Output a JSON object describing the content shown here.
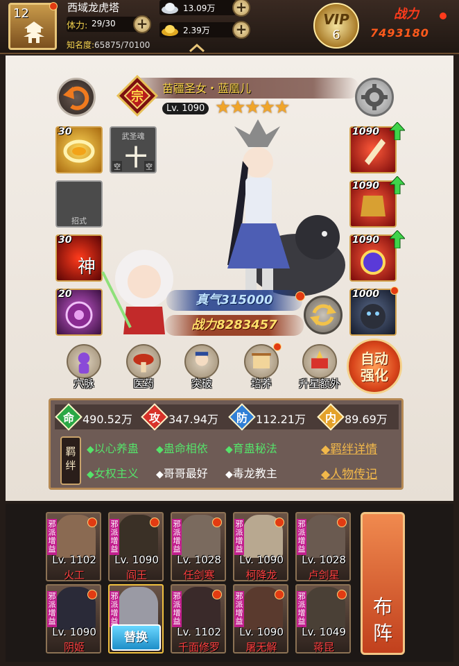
{
  "header": {
    "player_level": "12",
    "location": "西域龙虎塔",
    "stamina_label": "体力:",
    "stamina_value": "29/30",
    "fame_label": "知名度:",
    "fame_value": "65875/70100",
    "silver": "13.09万",
    "gold": "2.39万",
    "vip_label": "VIP",
    "vip_level": "6",
    "power_label": "战力",
    "power_value": "7493180"
  },
  "hero": {
    "rank_icon": "rank-badge-icon",
    "name": "苗疆圣女・蓝凰儿",
    "level": "Lv. 1090",
    "stars": "★★★★★",
    "zhenqi": "真气315000",
    "power": "战力8283457"
  },
  "left_slots": [
    {
      "level": "30",
      "icon": "gold-ring-icon"
    },
    {
      "level": "",
      "title": "武圣魂",
      "glyph": "十",
      "empty_left": "空",
      "empty_right": "空"
    },
    {
      "level": "",
      "title": "招式"
    },
    {
      "level": "30",
      "icon": "red-martial-icon",
      "glyph": "神"
    },
    {
      "level": "20",
      "icon": "purple-orb-icon"
    }
  ],
  "right_slots": [
    {
      "level": "1090",
      "icon": "weapon-icon"
    },
    {
      "level": "1090",
      "icon": "armor-icon"
    },
    {
      "level": "1090",
      "icon": "accessory-icon"
    },
    {
      "level": "1000",
      "icon": "beast-icon"
    }
  ],
  "actions": [
    "穴脉",
    "医药",
    "突破",
    "培养",
    "升星额外"
  ],
  "auto_button": [
    "自动",
    "强化"
  ],
  "stats": [
    {
      "char": "命",
      "value": "490.52万",
      "color": "#2aa845"
    },
    {
      "char": "攻",
      "value": "347.94万",
      "color": "#d8322a"
    },
    {
      "char": "防",
      "value": "112.21万",
      "color": "#2f7fd6"
    },
    {
      "char": "内",
      "value": "89.69万",
      "color": "#e3a12a"
    }
  ],
  "bond_tag": [
    "羁",
    "绊"
  ],
  "bonds_row1": [
    {
      "label": "以心养蛊",
      "active": true
    },
    {
      "label": "蛊命相依",
      "active": true
    },
    {
      "label": "育蛊秘法",
      "active": true
    }
  ],
  "bonds_row2": [
    {
      "label": "女权主义",
      "active": true
    },
    {
      "label": "哥哥最好",
      "active": false
    },
    {
      "label": "毒龙教主",
      "active": false
    }
  ],
  "links": [
    "◆羁绊详情",
    "◆人物传记"
  ],
  "roster": {
    "faction_tag": "邪派增益",
    "swap_label": "替换",
    "formation_label": [
      "布",
      "阵"
    ],
    "row1": [
      {
        "level": "Lv. 1102",
        "name": "火工"
      },
      {
        "level": "Lv. 1090",
        "name": "阎王"
      },
      {
        "level": "Lv. 1028",
        "name": "任剑寒"
      },
      {
        "level": "Lv. 1090",
        "name": "柯降龙"
      },
      {
        "level": "Lv. 1028",
        "name": "卢剑星"
      }
    ],
    "row2": [
      {
        "level": "Lv. 1090",
        "name": "阴姬"
      },
      {
        "level": "",
        "name": ""
      },
      {
        "level": "Lv. 1102",
        "name": "千面修罗"
      },
      {
        "level": "Lv. 1090",
        "name": "屠无解"
      },
      {
        "level": "Lv. 1049",
        "name": "蒋昆"
      }
    ]
  }
}
